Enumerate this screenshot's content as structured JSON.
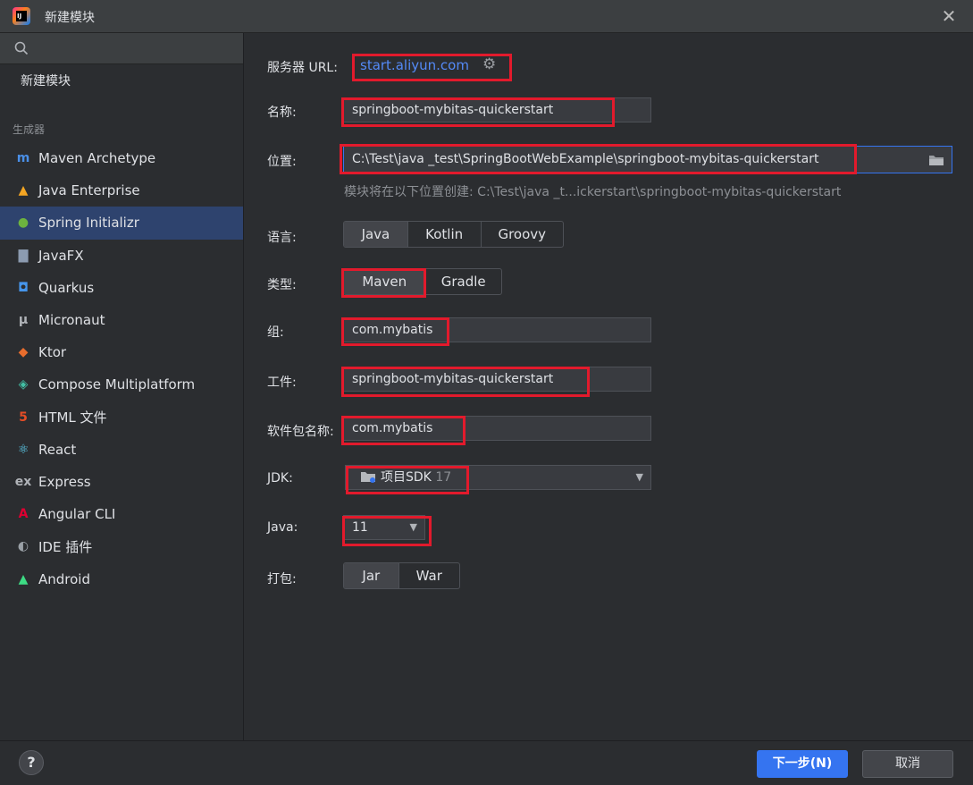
{
  "window": {
    "title": "新建模块"
  },
  "sidebar": {
    "search_placeholder": "",
    "new_module": "新建模块",
    "section_label": "生成器",
    "items": [
      {
        "label": "Maven Archetype",
        "icon": "maven-icon",
        "glyph": "m",
        "color": "#4a8fe7"
      },
      {
        "label": "Java Enterprise",
        "icon": "java-enterprise-icon",
        "glyph": "▲",
        "color": "#f5a623"
      },
      {
        "label": "Spring Initializr",
        "icon": "spring-icon",
        "glyph": "●",
        "color": "#6db33f",
        "selected": true
      },
      {
        "label": "JavaFX",
        "icon": "javafx-icon",
        "glyph": "▇",
        "color": "#8c9bb0"
      },
      {
        "label": "Quarkus",
        "icon": "quarkus-icon",
        "glyph": "◘",
        "color": "#4695eb"
      },
      {
        "label": "Micronaut",
        "icon": "micronaut-icon",
        "glyph": "μ",
        "color": "#b0b3b8"
      },
      {
        "label": "Ktor",
        "icon": "ktor-icon",
        "glyph": "◆",
        "color": "#e86d2d"
      },
      {
        "label": "Compose Multiplatform",
        "icon": "compose-icon",
        "glyph": "◈",
        "color": "#42c0a5"
      },
      {
        "label": "HTML 文件",
        "icon": "html-icon",
        "glyph": "5",
        "color": "#e44d26"
      },
      {
        "label": "React",
        "icon": "react-icon",
        "glyph": "⚛",
        "color": "#61dafb"
      },
      {
        "label": "Express",
        "icon": "express-icon",
        "glyph": "ex",
        "color": "#b0b3b8"
      },
      {
        "label": "Angular CLI",
        "icon": "angular-icon",
        "glyph": "A",
        "color": "#dd0031"
      },
      {
        "label": "IDE 插件",
        "icon": "plugin-icon",
        "glyph": "◐",
        "color": "#9aa0a6"
      },
      {
        "label": "Android",
        "icon": "android-icon",
        "glyph": "▲",
        "color": "#3ddc84"
      }
    ]
  },
  "form": {
    "server_url_label": "服务器 URL:",
    "server_url": "start.aliyun.com",
    "name_label": "名称:",
    "name_value": "springboot-mybitas-quickerstart",
    "location_label": "位置:",
    "location_value": "C:\\Test\\java _test\\SpringBootWebExample\\springboot-mybitas-quickerstart",
    "location_hint": "模块将在以下位置创建: C:\\Test\\java _t...ickerstart\\springboot-mybitas-quickerstart",
    "language_label": "语言:",
    "languages": [
      "Java",
      "Kotlin",
      "Groovy"
    ],
    "type_label": "类型:",
    "types": [
      "Maven",
      "Gradle"
    ],
    "group_label": "组:",
    "group_value": "com.mybatis",
    "artifact_label": "工件:",
    "artifact_value": "springboot-mybitas-quickerstart",
    "package_label": "软件包名称:",
    "package_value": "com.mybatis",
    "jdk_label": "JDK:",
    "jdk_name": "项目SDK",
    "jdk_version": "17",
    "java_label": "Java:",
    "java_value": "11",
    "packaging_label": "打包:",
    "packagings": [
      "Jar",
      "War"
    ]
  },
  "footer": {
    "help": "?",
    "next": "下一步(N)",
    "cancel": "取消"
  },
  "colors": {
    "accent": "#3574f0",
    "highlight": "#e21a2c",
    "link": "#548af7"
  }
}
